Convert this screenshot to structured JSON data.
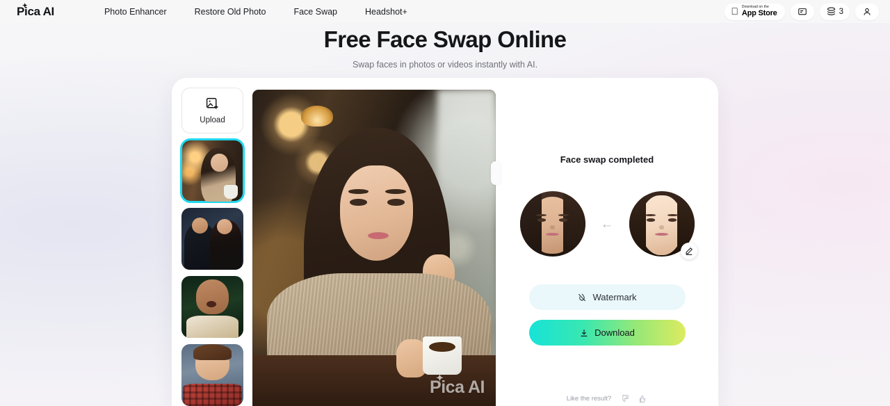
{
  "header": {
    "logo": "Pica AI",
    "logo_sparkle_icon": "sparkle-icon",
    "nav": [
      {
        "label": "Photo Enhancer",
        "name": "nav-photo-enhancer"
      },
      {
        "label": "Restore Old Photo",
        "name": "nav-restore-old-photo"
      },
      {
        "label": "Face Swap",
        "name": "nav-face-swap"
      },
      {
        "label": "Headshot+",
        "name": "nav-headshot-plus"
      }
    ],
    "appstore": {
      "small_label": "Download on the",
      "big_label": "App Store",
      "apple_icon": "apple-logo-icon"
    },
    "chat_icon": "chat-bubble-icon",
    "credits": {
      "icon": "credits-coins-icon",
      "count": "3"
    },
    "account_icon": "user-account-icon"
  },
  "hero": {
    "title": "Free Face Swap Online",
    "subtitle": "Swap faces in photos or videos instantly with AI."
  },
  "sidebar": {
    "upload": {
      "label": "Upload",
      "icon": "image-add-icon"
    },
    "thumbnails": [
      {
        "name": "thumbnail-woman-cafe",
        "selected": true,
        "alt": "Woman with wavy dark hair holding a coffee mug in a warm-lit cafe"
      },
      {
        "name": "thumbnail-couple-formal",
        "selected": false,
        "alt": "Man in tuxedo and woman in black dress"
      },
      {
        "name": "thumbnail-bald-man",
        "selected": false,
        "alt": "Bald muscular man with surprised expression"
      },
      {
        "name": "thumbnail-young-man-plaid",
        "selected": false,
        "alt": "Young man in red plaid shirt"
      }
    ]
  },
  "preview": {
    "alt": "Portrait of a woman with long wavy brown hair in a beige knit sweater holding a white coffee mug at a cafe table",
    "watermark": "Pica AI",
    "watermark_sparkle_icon": "sparkle-icon",
    "drag_handle_name": "preview-resize-handle"
  },
  "result_panel": {
    "status_title": "Face swap completed",
    "source_face_alt": "Source face - woman with dark hair",
    "target_face_alt": "Target face - woman with brown hair",
    "arrow_icon": "arrow-left-icon",
    "edit_icon": "pencil-edit-icon",
    "watermark_button": {
      "label": "Watermark",
      "icon": "watermark-off-icon"
    },
    "download_button": {
      "label": "Download",
      "icon": "download-icon"
    },
    "feedback": {
      "question": "Like the result?",
      "dislike_icon": "thumbs-down-icon",
      "like_icon": "thumbs-up-icon"
    }
  },
  "colors": {
    "selected_thumb_border": "#1fd8ef",
    "download_gradient_start": "#16e3d8",
    "download_gradient_mid": "#95e878",
    "download_gradient_end": "#ddeb5f",
    "watermark_button_bg": "#eaf7fb",
    "card_bg": "#ffffff",
    "header_bg": "#f7f7f8"
  }
}
